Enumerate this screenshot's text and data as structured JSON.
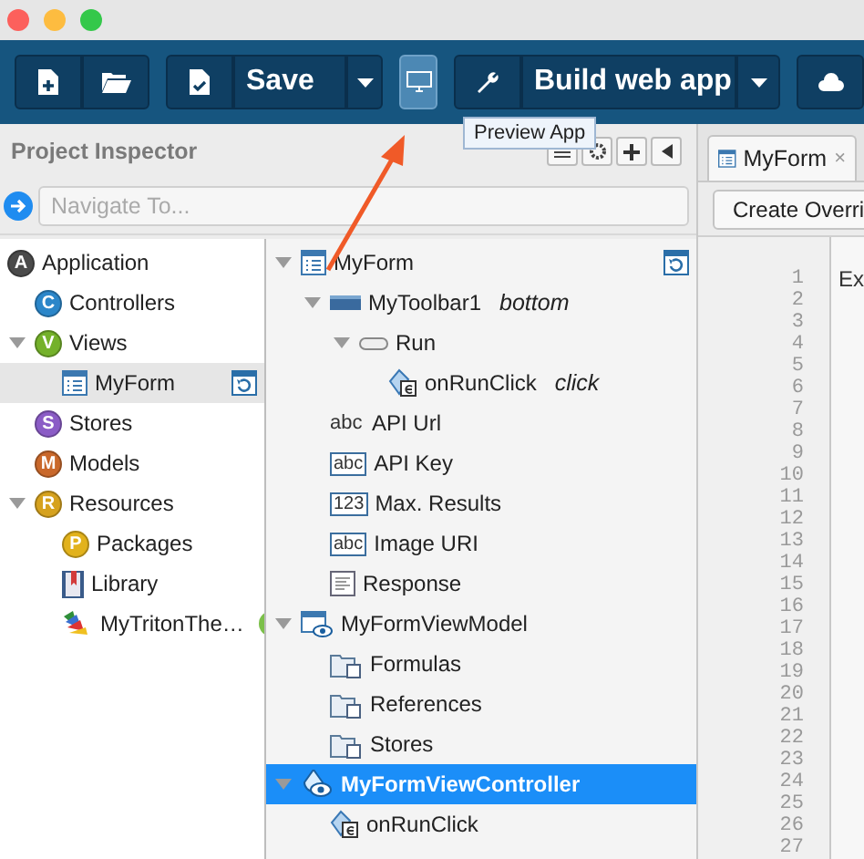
{
  "toolbar": {
    "save_label": "Save",
    "build_label": "Build web app",
    "preview": {
      "highlighted": true
    },
    "tooltip": "Preview App"
  },
  "inspector": {
    "title": "Project Inspector",
    "navigate_placeholder": "Navigate To...",
    "left_tree": [
      {
        "label": "Application",
        "kind": "badge",
        "badge": "A",
        "color": "#4a4a4a",
        "selected": false,
        "children": [
          {
            "label": "Controllers",
            "kind": "badge",
            "badge": "C",
            "color": "#2b86c9",
            "selected": false
          },
          {
            "label": "Views",
            "kind": "badge",
            "badge": "V",
            "color": "#74b12a",
            "selected": false,
            "expanded": true,
            "children": [
              {
                "label": "MyForm",
                "kind": "form",
                "selected": true,
                "refresh": true
              }
            ]
          },
          {
            "label": "Stores",
            "kind": "badge",
            "badge": "S",
            "color": "#8b5cc6",
            "selected": false
          },
          {
            "label": "Models",
            "kind": "badge",
            "badge": "M",
            "color": "#c9682b",
            "selected": false
          },
          {
            "label": "Resources",
            "kind": "badge",
            "badge": "R",
            "color": "#d6a21e",
            "selected": false,
            "expanded": true,
            "children": [
              {
                "label": "Packages",
                "kind": "badge",
                "badge": "P",
                "color": "#e2b21c",
                "selected": false
              },
              {
                "label": "Library",
                "kind": "library",
                "selected": false
              },
              {
                "label": "MyTritonThe…",
                "kind": "theme",
                "selected": false,
                "ok": true
              }
            ]
          }
        ]
      }
    ],
    "right_tree": [
      {
        "label": "MyForm",
        "kind": "form",
        "selected": false,
        "expanded": true,
        "refresh": true,
        "children": [
          {
            "label": "MyToolbar1",
            "detail": "bottom",
            "kind": "toolbar",
            "selected": false,
            "expanded": true,
            "children": [
              {
                "label": "Run",
                "kind": "button",
                "selected": false,
                "expanded": true,
                "children": [
                  {
                    "label": "onRunClick",
                    "detail": "click",
                    "kind": "event",
                    "selected": false
                  }
                ]
              }
            ]
          },
          {
            "label": "API Url",
            "kind": "text",
            "icon_text": "abc",
            "selected": false
          },
          {
            "label": "API Key",
            "kind": "field",
            "icon_text": "abc",
            "selected": false
          },
          {
            "label": "Max. Results",
            "kind": "field",
            "icon_text": "123",
            "selected": false
          },
          {
            "label": "Image URI",
            "kind": "field",
            "icon_text": "abc",
            "selected": false
          },
          {
            "label": "Response",
            "kind": "textarea",
            "selected": false
          }
        ]
      },
      {
        "label": "MyFormViewModel",
        "kind": "viewmodel",
        "selected": false,
        "expanded": true,
        "children": [
          {
            "label": "Formulas",
            "kind": "folder",
            "selected": false
          },
          {
            "label": "References",
            "kind": "folder",
            "selected": false
          },
          {
            "label": "Stores",
            "kind": "folder",
            "selected": false
          }
        ]
      },
      {
        "label": "MyFormViewController",
        "kind": "controller",
        "selected": true,
        "expanded": true,
        "children": [
          {
            "label": "onRunClick",
            "kind": "event",
            "selected": false
          }
        ]
      }
    ]
  },
  "editor": {
    "tab": {
      "label": "MyForm",
      "close": "×",
      "selected": true
    },
    "button": "Create Overri",
    "line_numbers": [
      "1",
      "2",
      "3",
      "4",
      "5",
      "6",
      "7",
      "8",
      "9",
      "10",
      "11",
      "12",
      "13",
      "14",
      "15",
      "16",
      "17",
      "18",
      "19",
      "20",
      "21",
      "22",
      "23",
      "24",
      "25",
      "26",
      "27"
    ],
    "lines": [
      "Ex"
    ]
  }
}
